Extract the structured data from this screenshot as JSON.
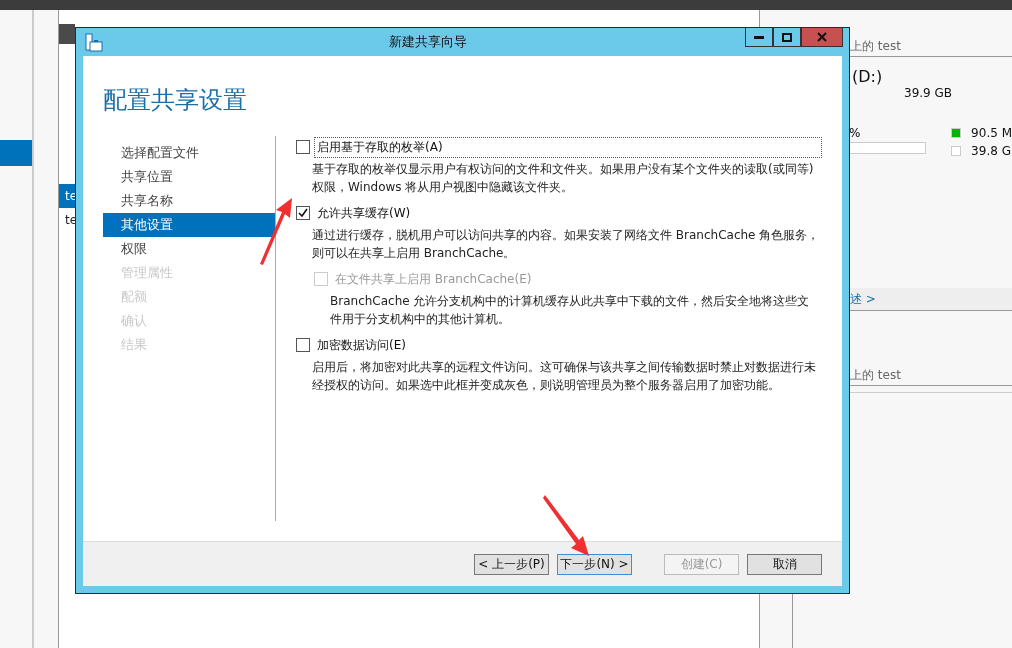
{
  "background": {
    "left_pane": {
      "items": [
        {
          "label": "te",
          "selected": true
        },
        {
          "label": "te",
          "selected": false
        }
      ]
    },
    "right_pane": {
      "volume_caption": "上的 test",
      "drive": "(D:)",
      "capacity": "39.9 GB",
      "percent": "%",
      "legend": [
        {
          "label": "90.5 M",
          "color": "#00b400"
        },
        {
          "label": "39.8 G",
          "color": "#ffffff"
        }
      ],
      "link": "述 >",
      "second_caption": "上的 test"
    }
  },
  "dialog": {
    "title": "新建共享向导",
    "heading": "配置共享设置",
    "steps": [
      {
        "label": "选择配置文件",
        "selected": false,
        "disabled": false
      },
      {
        "label": "共享位置",
        "selected": false,
        "disabled": false
      },
      {
        "label": "共享名称",
        "selected": false,
        "disabled": false
      },
      {
        "label": "其他设置",
        "selected": true,
        "disabled": false
      },
      {
        "label": "权限",
        "selected": false,
        "disabled": false
      },
      {
        "label": "管理属性",
        "selected": false,
        "disabled": true
      },
      {
        "label": "配额",
        "selected": false,
        "disabled": true
      },
      {
        "label": "确认",
        "selected": false,
        "disabled": true
      },
      {
        "label": "结果",
        "selected": false,
        "disabled": true
      }
    ],
    "options": [
      {
        "label": "启用基于存取的枚举(A)",
        "checked": false,
        "disabled": false,
        "focused": true,
        "description": "基于存取的枚举仅显示用户有权访问的文件和文件夹。如果用户没有某个文件夹的读取(或同等)权限，Windows 将从用户视图中隐藏该文件夹。"
      },
      {
        "label": "允许共享缓存(W)",
        "checked": true,
        "disabled": false,
        "focused": false,
        "description": "通过进行缓存，脱机用户可以访问共享的内容。如果安装了网络文件 BranchCache 角色服务，则可以在共享上启用 BranchCache。",
        "children": [
          {
            "label": "在文件共享上启用 BranchCache(E)",
            "checked": false,
            "disabled": true,
            "focused": false,
            "description": "BranchCache 允许分支机构中的计算机缓存从此共享中下载的文件，然后安全地将这些文件用于分支机构中的其他计算机。"
          }
        ]
      },
      {
        "label": "加密数据访问(E)",
        "checked": false,
        "disabled": false,
        "focused": false,
        "description": "启用后，将加密对此共享的远程文件访问。这可确保与该共享之间传输数据时禁止对数据进行未经授权的访问。如果选中此框并变成灰色，则说明管理员为整个服务器启用了加密功能。"
      }
    ],
    "buttons": [
      {
        "label": "< 上一步(P)",
        "disabled": false,
        "focused": false
      },
      {
        "label": "下一步(N) >",
        "disabled": false,
        "focused": true
      },
      {
        "label": "创建(C)",
        "disabled": true,
        "focused": false
      },
      {
        "label": "取消",
        "disabled": false,
        "focused": false
      }
    ]
  }
}
